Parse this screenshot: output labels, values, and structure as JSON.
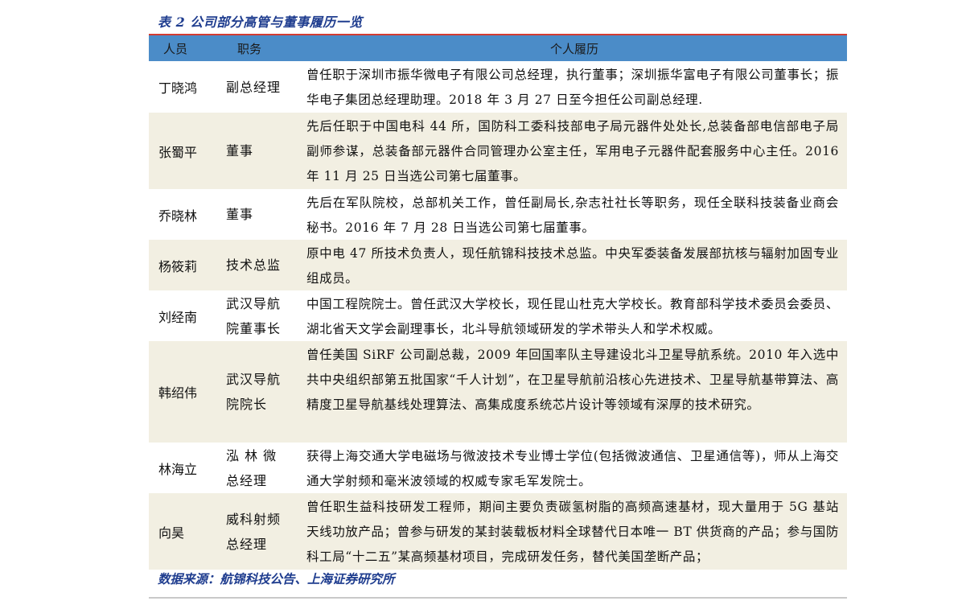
{
  "title": "表 2  公司部分高管与董事履历一览",
  "headers": {
    "name": "人员",
    "position": "职务",
    "resume": "个人履历"
  },
  "rows": [
    {
      "name": "丁晓鸿",
      "position": "副总经理",
      "resume": "曾任职于深圳市振华微电子有限公司总经理，执行董事；深圳振华富电子有限公司董事长；振华电子集团总经理助理。2018 年 3 月 27 日至今担任公司副总经理."
    },
    {
      "name": "张蜀平",
      "position": "董事",
      "resume": "先后任职于中国电科 44 所，国防科工委科技部电子局元器件处处长,总装备部电信部电子局副师参谋，总装备部元器件合同管理办公室主任，军用电子元器件配套服务中心主任。2016 年 11 月 25 日当选公司第七届董事。"
    },
    {
      "name": "乔晓林",
      "position": "董事",
      "resume": "先后在军队院校，总部机关工作，曾任副局长,杂志社社长等职务，现任全联科技装备业商会秘书。2016 年 7 月 28 日当选公司第七届董事。"
    },
    {
      "name": "杨筱莉",
      "position": "技术总监",
      "resume": "原中电 47 所技术负责人，现任航锦科技技术总监。中央军委装备发展部抗核与辐射加固专业组成员。"
    },
    {
      "name": "刘经南",
      "position": "武汉导航院董事长",
      "resume": "中国工程院院士。曾任武汉大学校长，现任昆山杜克大学校长。教育部科学技术委员会委员、湖北省天文学会副理事长，北斗导航领域研发的学术带头人和学术权威。"
    },
    {
      "name": "韩绍伟",
      "position": "武汉导航院院长",
      "resume": "曾任美国 SiRF 公司副总裁，2009 年回国率队主导建设北斗卫星导航系统。2010 年入选中共中央组织部第五批国家“千人计划”，在卫星导航前沿核心先进技术、卫星导航基带算法、高精度卫星导航基线处理算法、高集成度系统芯片设计等领域有深厚的技术研究。"
    },
    {
      "name": "林海立",
      "position": "泓 林 微总经理",
      "resume": "获得上海交通大学电磁场与微波技术专业博士学位(包括微波通信、卫星通信等)，师从上海交通大学射频和毫米波领域的权威专家毛军发院士。"
    },
    {
      "name": "向昊",
      "position": "威科射频总经理",
      "resume": "曾任职生益科技研发工程师，期间主要负责碳氢树脂的高频高速基材，现大量用于 5G 基站天线功放产品；曾参与研发的某封装载板材料全球替代日本唯一 BT 供货商的产品；参与国防科工局“十二五”某高频基材项目，完成研发任务，替代美国垄断产品；"
    }
  ],
  "source": "数据来源：航锦科技公告、上海证券研究所",
  "colors": {
    "header_bg": "#4b8cc8",
    "header_top_rule": "#d43b32",
    "alt_row_bg": "#f2efe2",
    "caption_color": "#1f3d8f"
  }
}
